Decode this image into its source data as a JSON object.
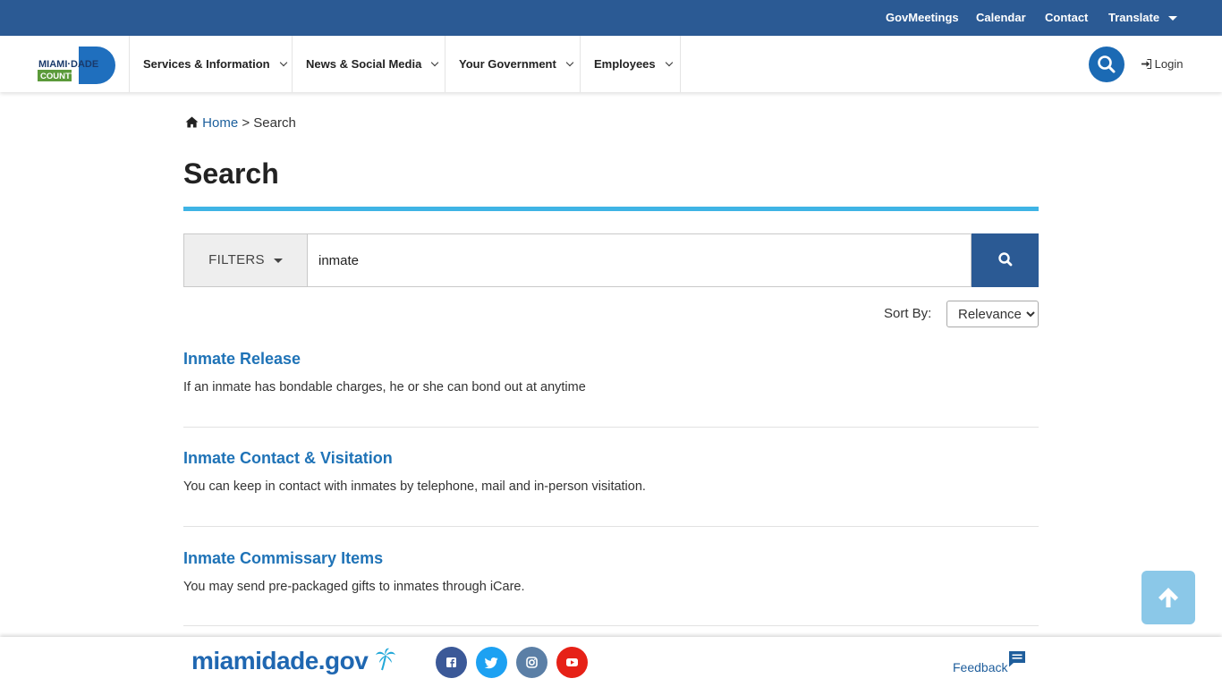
{
  "utility": {
    "links": [
      "GovMeetings",
      "Calendar",
      "Contact",
      "Translate"
    ]
  },
  "nav": {
    "logo_top": "MIAMI·DADE",
    "logo_bottom": "COUNTY",
    "items": [
      "Services & Information",
      "News & Social Media",
      "Your Government",
      "Employees"
    ],
    "login": "Login"
  },
  "breadcrumb": {
    "home": "Home",
    "separator": ">",
    "current": "Search"
  },
  "page": {
    "title": "Search"
  },
  "search": {
    "filters_label": "FILTERS",
    "query": "inmate",
    "sort_label": "Sort By:",
    "sort_selected": "Relevance"
  },
  "results": [
    {
      "title": "Inmate Release",
      "description": "If an inmate has bondable charges, he or she can bond out at anytime"
    },
    {
      "title": "Inmate Contact & Visitation",
      "description": "You can keep in contact with inmates by telephone, mail and in-person visitation."
    },
    {
      "title": "Inmate Commissary Items",
      "description": "You may send pre-packaged gifts to inmates through iCare."
    }
  ],
  "footer": {
    "logo": "miamidade.gov",
    "social": [
      "facebook-icon",
      "twitter-icon",
      "instagram-icon",
      "youtube-icon"
    ],
    "feedback": "Feedback"
  },
  "colors": {
    "utility_bar": "#2b5a94",
    "accent_rule": "#3fb4e5",
    "link": "#1f73b7",
    "facebook": "#3b5998",
    "twitter": "#1da1f2",
    "instagram": "#5b7fa6",
    "youtube": "#e62117"
  }
}
